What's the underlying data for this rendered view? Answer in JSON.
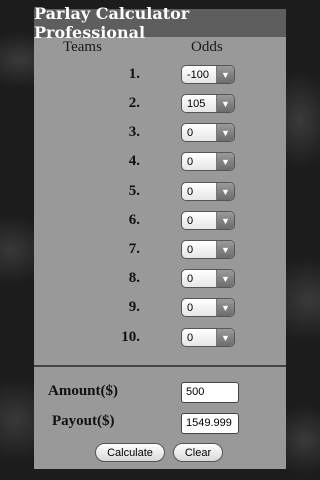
{
  "app": {
    "title": "Parlay Calculator Professional"
  },
  "headers": {
    "teams": "Teams",
    "odds": "Odds"
  },
  "rows": [
    {
      "label": "1.",
      "odds": "-100"
    },
    {
      "label": "2.",
      "odds": "105"
    },
    {
      "label": "3.",
      "odds": "0"
    },
    {
      "label": "4.",
      "odds": "0"
    },
    {
      "label": "5.",
      "odds": "0"
    },
    {
      "label": "6.",
      "odds": "0"
    },
    {
      "label": "7.",
      "odds": "0"
    },
    {
      "label": "8.",
      "odds": "0"
    },
    {
      "label": "9.",
      "odds": "0"
    },
    {
      "label": "10.",
      "odds": "0"
    }
  ],
  "amount": {
    "label": "Amount($)",
    "value": "500"
  },
  "payout": {
    "label": "Payout($)",
    "value": "1549.999"
  },
  "buttons": {
    "calculate": "Calculate",
    "clear": "Clear"
  },
  "colors": {
    "panel": "#999999",
    "title_bar": "#5e5e5e",
    "background": "#1c1c1c"
  }
}
